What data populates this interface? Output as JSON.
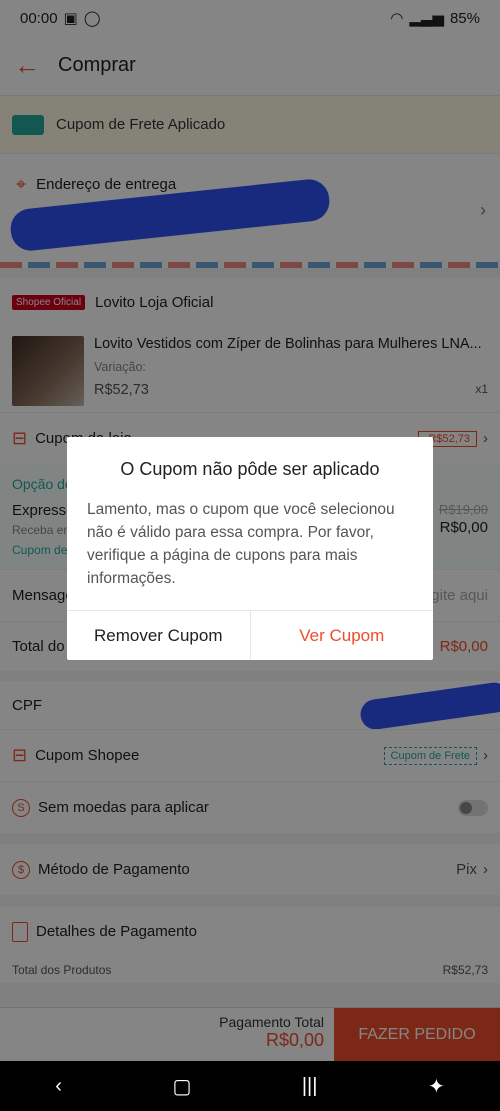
{
  "status": {
    "time": "00:00",
    "battery": "85%"
  },
  "appbar": {
    "title": "Comprar"
  },
  "banner": {
    "text": "Cupom de Frete Aplicado"
  },
  "address": {
    "label": "Endereço de entrega"
  },
  "shop": {
    "badge": "Shopee Oficial",
    "name": "Lovito Loja Oficial"
  },
  "product": {
    "name": "Lovito Vestidos com Zíper de Bolinhas para Mulheres LNA...",
    "variation": "Variação:",
    "price": "R$52,73",
    "qty": "x1"
  },
  "seller_coupon": {
    "label": "Cupom da loja",
    "tag": "-R$52,73"
  },
  "shipping": {
    "header": "Opção de envio",
    "method": "Expresso",
    "old_price": "R$19,00",
    "price": "R$0,00",
    "note": "Receba entre",
    "coupon": "Cupom de frete"
  },
  "message": {
    "label": "Mensagem:",
    "placeholder": "Digite aqui"
  },
  "order_total": {
    "label": "Total do Pedido (1 item):",
    "value": "R$0,00"
  },
  "cpf": {
    "label": "CPF"
  },
  "shopee_coupon": {
    "label": "Cupom Shopee",
    "tag": "Cupom de Frete"
  },
  "coins": {
    "label": "Sem moedas para aplicar"
  },
  "payment": {
    "label": "Método de Pagamento",
    "value": "Pix"
  },
  "details": {
    "label": "Detalhes de Pagamento",
    "products_label": "Total dos Produtos",
    "products_value": "R$52,73"
  },
  "bottom": {
    "total_label": "Pagamento Total",
    "total_value": "R$0,00",
    "button": "FAZER PEDIDO"
  },
  "dialog": {
    "title": "O Cupom não pôde ser aplicado",
    "body": "Lamento, mas o cupom que você selecionou não é válido para essa compra. Por favor, verifique a página de cupons para mais informações.",
    "cancel": "Remover Cupom",
    "confirm": "Ver Cupom"
  }
}
